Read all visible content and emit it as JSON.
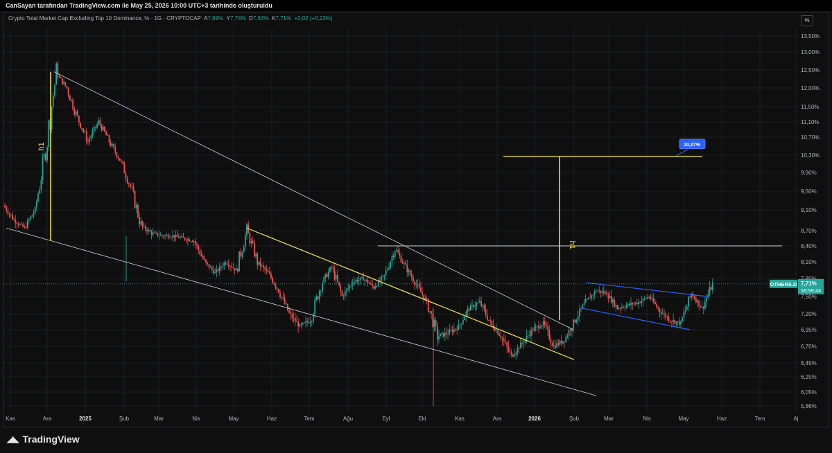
{
  "header": {
    "credit": "CanSayan tarafından TradingView.com ile May 25, 2026 10:00 UTC+3 tarihinde oluşturuldu"
  },
  "legend": {
    "symbol_title": "Crypto Total Market Cap Excluding Top 10 Dominance, % · 1G · CRYPTOCAP",
    "open_label": "A",
    "open_value": "7,69%",
    "high_label": "Y",
    "high_value": "7,74%",
    "low_label": "D",
    "low_value": "7,63%",
    "close_label": "K",
    "close_value": "7,71%",
    "change": "+0,02 (+0,23%)"
  },
  "scale_button": "%",
  "footer": {
    "brand": "TradingView"
  },
  "chart_data": {
    "type": "candlestick",
    "symbol": "OTHERS.D",
    "interval": "1G",
    "y_unit": "%",
    "y_ticks": [
      "13,50%",
      "13,00%",
      "12,50%",
      "12,00%",
      "11,50%",
      "11,10%",
      "10,70%",
      "10,30%",
      "9,90%",
      "9,50%",
      "9,10%",
      "8,70%",
      "8,40%",
      "8,10%",
      "7,80%",
      "7,50%",
      "7,20%",
      "6,95%",
      "6,70%",
      "6,45%",
      "6,25%",
      "6,05%",
      "5,86%"
    ],
    "x_ticks": [
      "Kas",
      "Ara",
      "2025",
      "Şub",
      "Mar",
      "Nis",
      "May",
      "Haz",
      "Tem",
      "Ağu",
      "Eyl",
      "Eki",
      "Kas",
      "Ara",
      "2026",
      "Şub",
      "Mar",
      "Nis",
      "May",
      "Haz",
      "Tem",
      "Aj"
    ],
    "price_path": [
      {
        "t": "Kas",
        "v": 9.2
      },
      {
        "t": "Kas",
        "v": 8.9
      },
      {
        "t": "Kas",
        "v": 8.75
      },
      {
        "t": "Kas",
        "v": 9.1
      },
      {
        "t": "Ara",
        "v": 10.4
      },
      {
        "t": "Ara",
        "v": 12.4
      },
      {
        "t": "Ara",
        "v": 12.0
      },
      {
        "t": "Ara",
        "v": 11.2
      },
      {
        "t": "2025",
        "v": 10.6
      },
      {
        "t": "2025",
        "v": 11.1
      },
      {
        "t": "2025",
        "v": 10.6
      },
      {
        "t": "2025",
        "v": 10.2
      },
      {
        "t": "Şub",
        "v": 9.6
      },
      {
        "t": "Şub",
        "v": 8.8
      },
      {
        "t": "Şub",
        "v": 8.65
      },
      {
        "t": "Mar",
        "v": 8.6
      },
      {
        "t": "Mar",
        "v": 8.6
      },
      {
        "t": "Mar",
        "v": 8.55
      },
      {
        "t": "Nis",
        "v": 8.5
      },
      {
        "t": "Nis",
        "v": 8.1
      },
      {
        "t": "Nis",
        "v": 7.9
      },
      {
        "t": "Nis",
        "v": 8.1
      },
      {
        "t": "May",
        "v": 7.95
      },
      {
        "t": "May",
        "v": 8.7
      },
      {
        "t": "May",
        "v": 8.1
      },
      {
        "t": "Haz",
        "v": 7.9
      },
      {
        "t": "Haz",
        "v": 7.6
      },
      {
        "t": "Haz",
        "v": 7.2
      },
      {
        "t": "Haz",
        "v": 7.0
      },
      {
        "t": "Tem",
        "v": 7.1
      },
      {
        "t": "Tem",
        "v": 7.7
      },
      {
        "t": "Tem",
        "v": 8.0
      },
      {
        "t": "Tem",
        "v": 7.5
      },
      {
        "t": "Ağu",
        "v": 7.75
      },
      {
        "t": "Ağu",
        "v": 7.8
      },
      {
        "t": "Ağu",
        "v": 7.65
      },
      {
        "t": "Eyl",
        "v": 7.85
      },
      {
        "t": "Eyl",
        "v": 8.35
      },
      {
        "t": "Eyl",
        "v": 8.0
      },
      {
        "t": "Eki",
        "v": 7.7
      },
      {
        "t": "Eki",
        "v": 7.4
      },
      {
        "t": "Eki",
        "v": 6.85
      },
      {
        "t": "Eki",
        "v": 6.9
      },
      {
        "t": "Kas",
        "v": 7.0
      },
      {
        "t": "Kas",
        "v": 7.3
      },
      {
        "t": "Kas",
        "v": 7.4
      },
      {
        "t": "Ara",
        "v": 7.05
      },
      {
        "t": "Ara",
        "v": 6.85
      },
      {
        "t": "Ara",
        "v": 6.55
      },
      {
        "t": "Ara",
        "v": 6.75
      },
      {
        "t": "2026",
        "v": 6.95
      },
      {
        "t": "2026",
        "v": 7.05
      },
      {
        "t": "2026",
        "v": 6.7
      },
      {
        "t": "2026",
        "v": 6.8
      },
      {
        "t": "Şub",
        "v": 7.1
      },
      {
        "t": "Şub",
        "v": 7.4
      },
      {
        "t": "Şub",
        "v": 7.6
      },
      {
        "t": "Mar",
        "v": 7.55
      },
      {
        "t": "Mar",
        "v": 7.3
      },
      {
        "t": "Mar",
        "v": 7.35
      },
      {
        "t": "Nis",
        "v": 7.4
      },
      {
        "t": "Nis",
        "v": 7.5
      },
      {
        "t": "Nis",
        "v": 7.25
      },
      {
        "t": "Nis",
        "v": 7.1
      },
      {
        "t": "May",
        "v": 7.05
      },
      {
        "t": "May",
        "v": 7.55
      },
      {
        "t": "May",
        "v": 7.3
      },
      {
        "t": "May",
        "v": 7.71
      }
    ],
    "last_price_label": "OTHERS.D",
    "last_price": "7,71%",
    "countdown": "16:59:44",
    "measure_label": "h1",
    "target_label": "10,27%",
    "target_value": 10.27,
    "horizontal_level": 8.4,
    "colors": {
      "up": "#26a69a",
      "down": "#ef5350",
      "wedge": "#d1d4dc",
      "channel": "#f5e645",
      "flag": "#2962ff",
      "last": "#26a69a"
    },
    "grid": true
  }
}
